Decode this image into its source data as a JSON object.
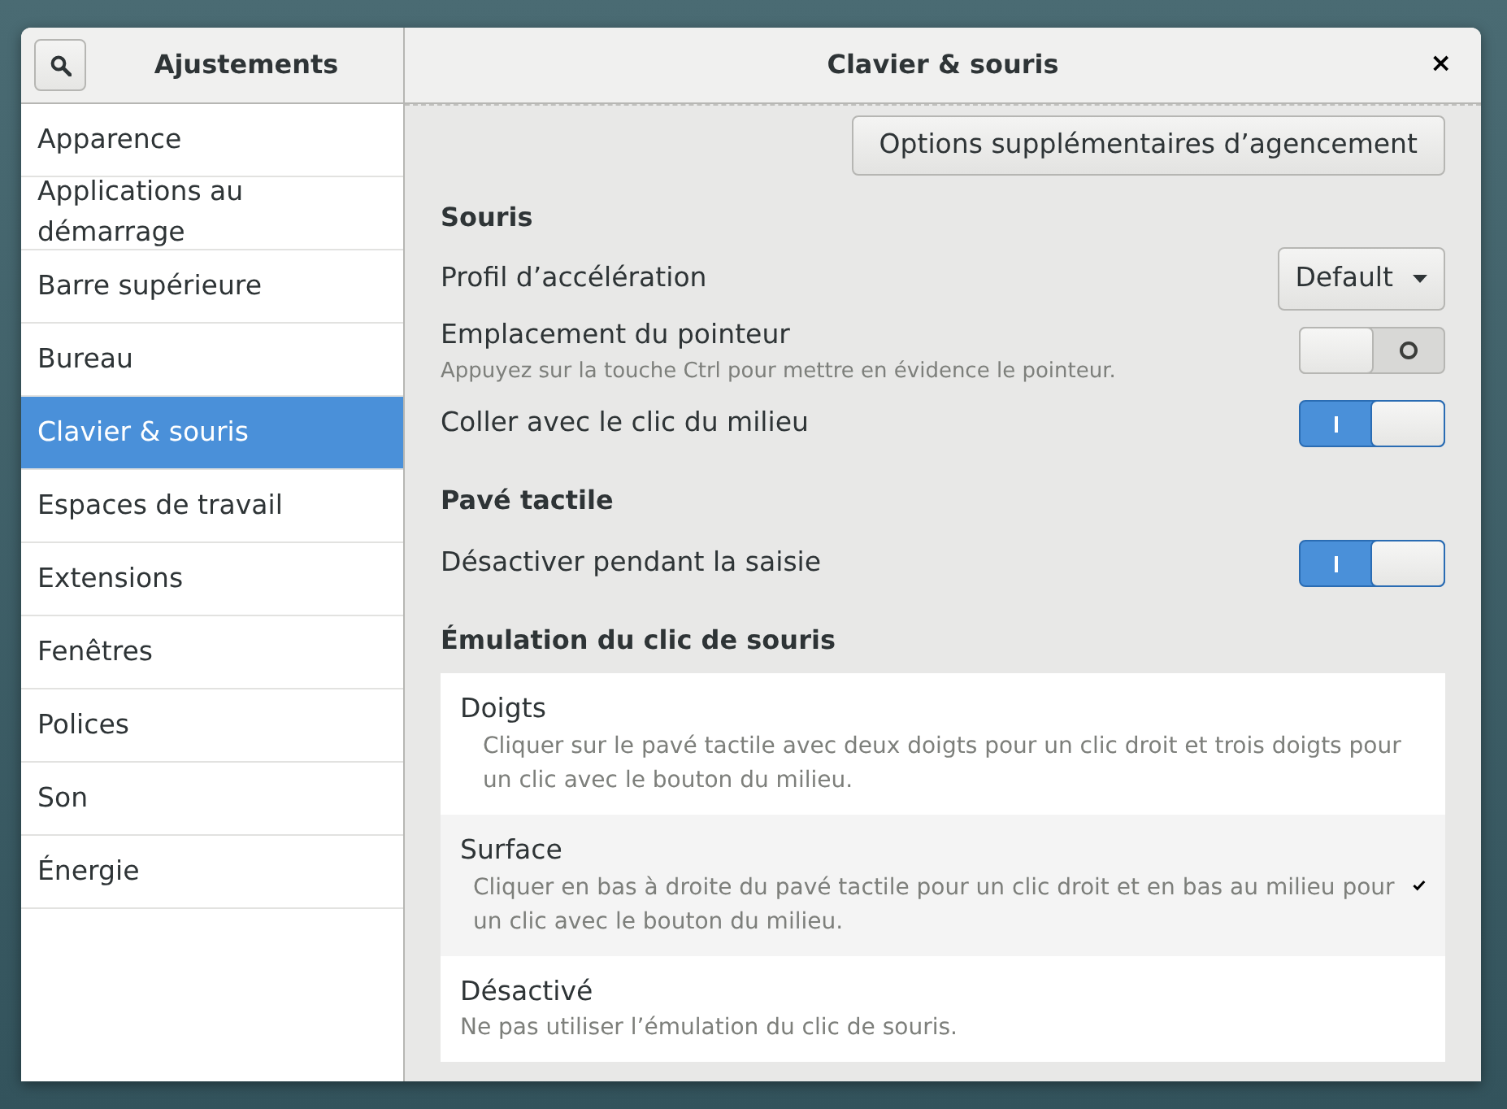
{
  "window": {
    "app_title": "Ajustements",
    "page_title": "Clavier & souris",
    "close": "×"
  },
  "sidebar": {
    "items": [
      {
        "label": "Apparence",
        "selected": false
      },
      {
        "label": "Applications au démarrage",
        "selected": false
      },
      {
        "label": "Barre supérieure",
        "selected": false
      },
      {
        "label": "Bureau",
        "selected": false
      },
      {
        "label": "Clavier & souris",
        "selected": true
      },
      {
        "label": "Espaces de travail",
        "selected": false
      },
      {
        "label": "Extensions",
        "selected": false
      },
      {
        "label": "Fenêtres",
        "selected": false
      },
      {
        "label": "Polices",
        "selected": false
      },
      {
        "label": "Son",
        "selected": false
      },
      {
        "label": "Énergie",
        "selected": false
      }
    ]
  },
  "top_button": "Options supplémentaires d’agencement",
  "sections": [
    {
      "title": "Souris",
      "rows": [
        {
          "kind": "dropdown",
          "label": "Profil d’accélération",
          "value": "Default"
        },
        {
          "kind": "switch",
          "label": "Emplacement du pointeur",
          "description": "Appuyez sur la touche Ctrl pour mettre en évidence le pointeur.",
          "on": false
        },
        {
          "kind": "switch",
          "label": "Coller avec le clic du milieu",
          "on": true
        }
      ]
    },
    {
      "title": "Pavé tactile",
      "rows": [
        {
          "kind": "switch",
          "label": "Désactiver pendant la saisie",
          "on": true
        }
      ]
    },
    {
      "title": "Émulation du clic de souris",
      "options": [
        {
          "label": "Doigts",
          "description": "Cliquer sur le pavé tactile avec deux doigts pour un clic droit et trois doigts pour un clic avec le bouton du milieu.",
          "selected": false
        },
        {
          "label": "Surface",
          "description": "Cliquer en bas à droite du pavé tactile pour un clic droit et en bas au milieu pour un clic avec le bouton du milieu.",
          "selected": true
        },
        {
          "label": "Désactivé",
          "description": "Ne pas utiliser l’émulation du clic de souris.",
          "selected": false
        }
      ]
    }
  ]
}
